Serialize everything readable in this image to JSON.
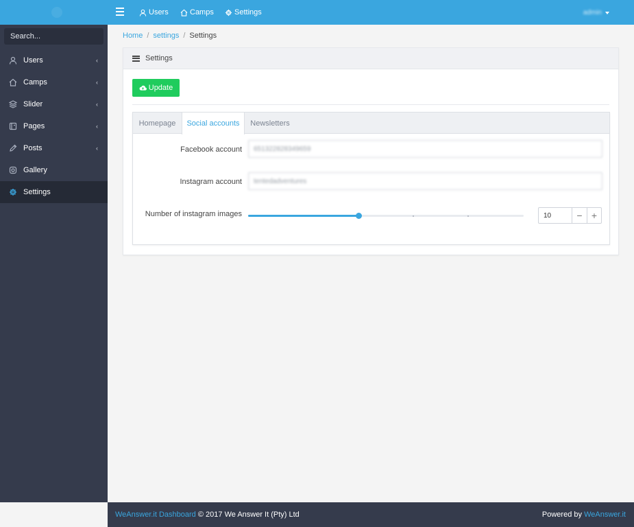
{
  "sidebar": {
    "search_placeholder": "Search...",
    "items": [
      {
        "label": "Users",
        "icon": "user-icon",
        "has_submenu": true
      },
      {
        "label": "Camps",
        "icon": "home-icon",
        "has_submenu": true
      },
      {
        "label": "Slider",
        "icon": "layers-icon",
        "has_submenu": true
      },
      {
        "label": "Pages",
        "icon": "pages-icon",
        "has_submenu": true
      },
      {
        "label": "Posts",
        "icon": "pencil-icon",
        "has_submenu": true
      },
      {
        "label": "Gallery",
        "icon": "instagram-icon",
        "has_submenu": false
      },
      {
        "label": "Settings",
        "icon": "gear-icon",
        "has_submenu": false,
        "active": true
      }
    ],
    "chevron": "‹"
  },
  "topbar": {
    "links": [
      {
        "label": "Users",
        "icon": "user-icon"
      },
      {
        "label": "Camps",
        "icon": "home-icon"
      },
      {
        "label": "Settings",
        "icon": "gear-icon"
      }
    ],
    "user": "admin"
  },
  "breadcrumb": {
    "items": [
      "Home",
      "settings",
      "Settings"
    ],
    "separator": "/"
  },
  "card": {
    "title": "Settings",
    "update_button": "Update"
  },
  "tabs": [
    {
      "label": "Homepage",
      "active": false
    },
    {
      "label": "Social accounts",
      "active": true
    },
    {
      "label": "Newsletters",
      "active": false
    }
  ],
  "form": {
    "facebook_label": "Facebook account",
    "facebook_value": "651322828349659",
    "instagram_label": "Instagram account",
    "instagram_value": "tentedadventures",
    "images_label": "Number of instagram images",
    "images_value": "10",
    "slider_level_percent": 40,
    "minus": "−",
    "plus": "+"
  },
  "footer": {
    "brand_link": "WeAnswer.it Dashboard",
    "copyright": "© 2017 We Answer It (Pty) Ltd",
    "powered_by": "Powered by",
    "powered_link": "WeAnswer.it"
  },
  "colors": {
    "accent": "#3aa6df",
    "sidebar_bg": "#353b4c",
    "success": "#1fcc5d"
  }
}
